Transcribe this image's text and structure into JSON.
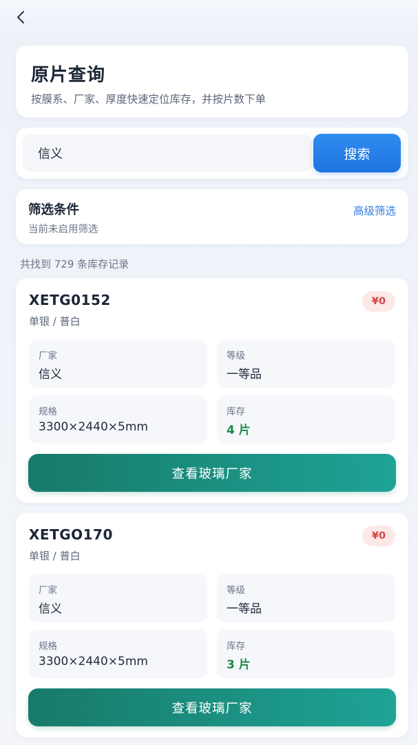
{
  "header": {
    "title": "原片查询",
    "subtitle": "按膜系、厂家、厚度快速定位库存，并按片数下单"
  },
  "search": {
    "value": "信义",
    "button_label": "搜索"
  },
  "filter": {
    "title": "筛选条件",
    "status": "当前未启用筛选",
    "advanced_label": "高级筛选"
  },
  "results": {
    "count_text": "共找到 729 条库存记录"
  },
  "items": [
    {
      "code": "XETG0152",
      "type": "单银 / 普白",
      "price": "¥0",
      "fields": [
        {
          "label": "厂家",
          "value": "信义"
        },
        {
          "label": "等级",
          "value": "一等品"
        },
        {
          "label": "规格",
          "value": "3300×2440×5mm"
        },
        {
          "label": "库存",
          "value": "4 片"
        }
      ],
      "action_label": "查看玻璃厂家"
    },
    {
      "code": "XETGO170",
      "type": "单银 / 普白",
      "price": "¥0",
      "fields": [
        {
          "label": "厂家",
          "value": "信义"
        },
        {
          "label": "等级",
          "value": "一等品"
        },
        {
          "label": "规格",
          "value": "3300×2440×5mm"
        },
        {
          "label": "库存",
          "value": "3 片"
        }
      ],
      "action_label": "查看玻璃厂家"
    }
  ],
  "icons": {
    "back": "chevron-left-icon"
  },
  "colors": {
    "primary_blue": "#2f8cf0",
    "action_teal": "#187a6a",
    "stock_green": "#1e8a4a",
    "price_red": "#d64545"
  }
}
